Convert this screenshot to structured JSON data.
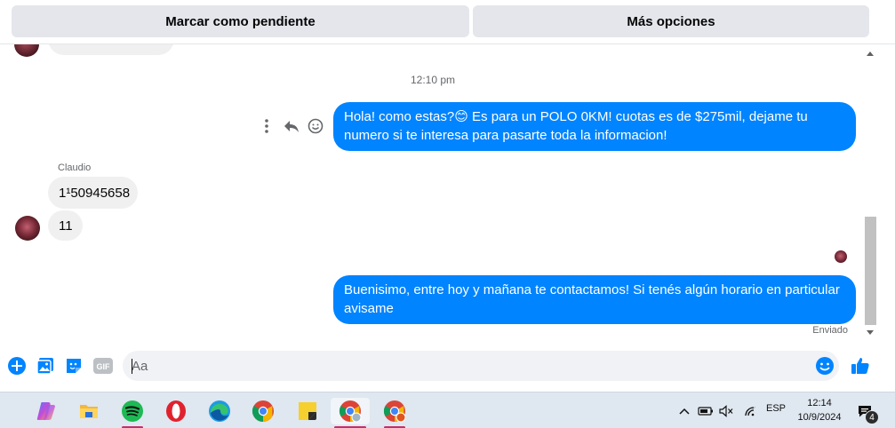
{
  "top_actions": {
    "mark_pending": "Marcar como pendiente",
    "more_options": "Más opciones"
  },
  "chat": {
    "timestamp": "12:10 pm",
    "outgoing_1": "Hola! como estas?😊 Es para un POLO 0KM! cuotas es de $275mil, dejame tu numero si te interesa para pasarte toda la informacion!",
    "sender_name": "Claudio",
    "incoming_1": "1¹50945658",
    "incoming_2": "11",
    "outgoing_2": "Buenisimo, entre hoy y mañana te contactamos! Si tenés algún horario en particular avisame",
    "status": "Enviado"
  },
  "composer": {
    "placeholder": "Aa",
    "icons": [
      "plus-circle-icon",
      "photo-icon",
      "sticker-icon",
      "gif-icon",
      "emoji-icon",
      "thumbs-up-icon"
    ]
  },
  "taskbar": {
    "apps": [
      "copilot-icon",
      "file-explorer-icon",
      "spotify-icon",
      "opera-icon",
      "edge-icon",
      "chrome-icon",
      "sticky-notes-icon",
      "chrome-profile-icon",
      "chrome-profile-2-icon"
    ],
    "language": "ESP",
    "time": "12:14",
    "date": "10/9/2024",
    "notifications": "4"
  },
  "colors": {
    "accent": "#0084ff",
    "incoming_bubble": "#f0f0f0",
    "button_bg": "#e4e6eb"
  }
}
